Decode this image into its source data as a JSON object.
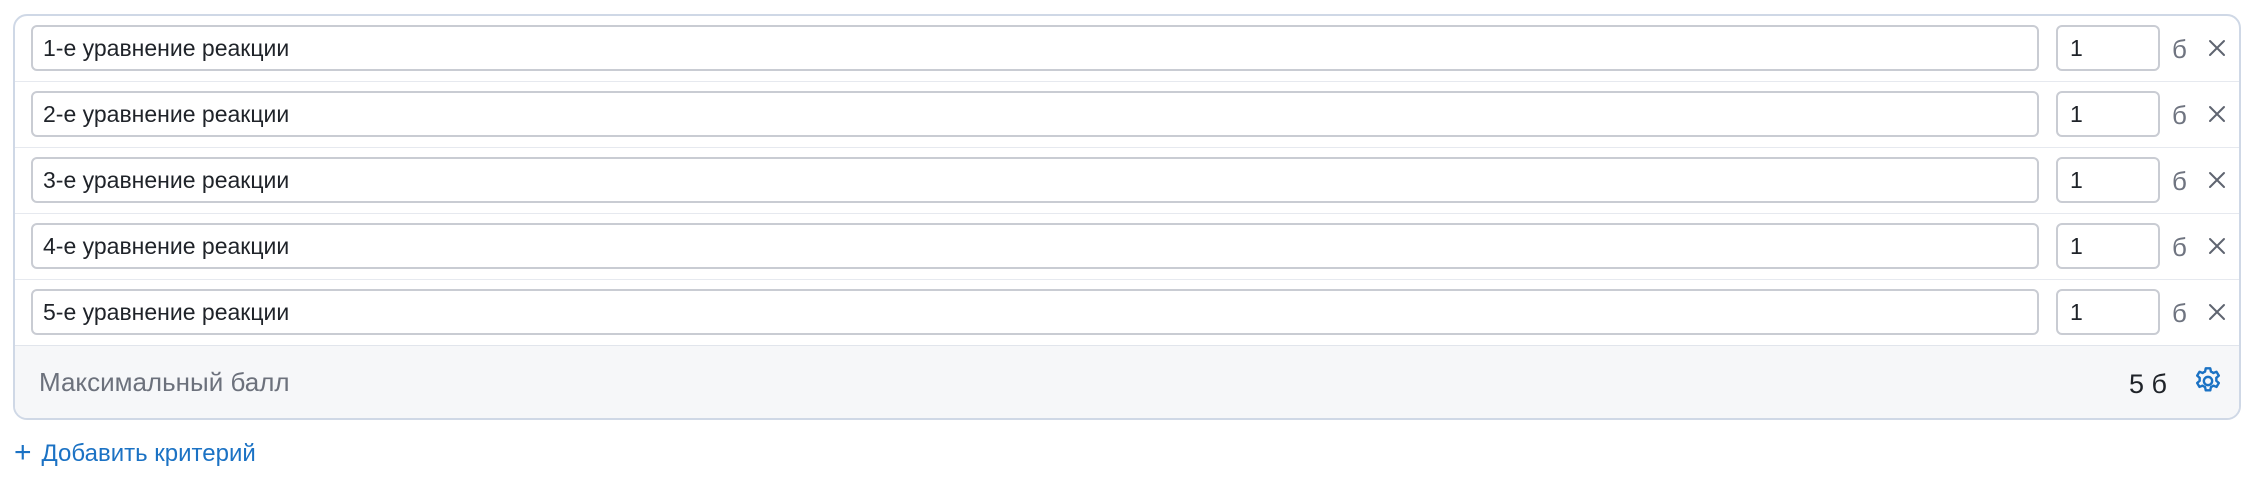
{
  "criteria": [
    {
      "label": "1-е уравнение реакции",
      "score": "1",
      "unit": "б"
    },
    {
      "label": "2-е уравнение реакции",
      "score": "1",
      "unit": "б"
    },
    {
      "label": "3-е уравнение реакции",
      "score": "1",
      "unit": "б"
    },
    {
      "label": "4-е уравнение реакции",
      "score": "1",
      "unit": "б"
    },
    {
      "label": "5-е уравнение реакции",
      "score": "1",
      "unit": "б"
    }
  ],
  "footer": {
    "max_label": "Максимальный балл",
    "max_value": "5 б",
    "settings_icon": "gear-icon"
  },
  "actions": {
    "add_label": "Добавить критерий",
    "add_icon": "+"
  },
  "colors": {
    "accent": "#1b72c4",
    "border": "#cfd8e6",
    "footer_bg": "#f6f7f9"
  }
}
